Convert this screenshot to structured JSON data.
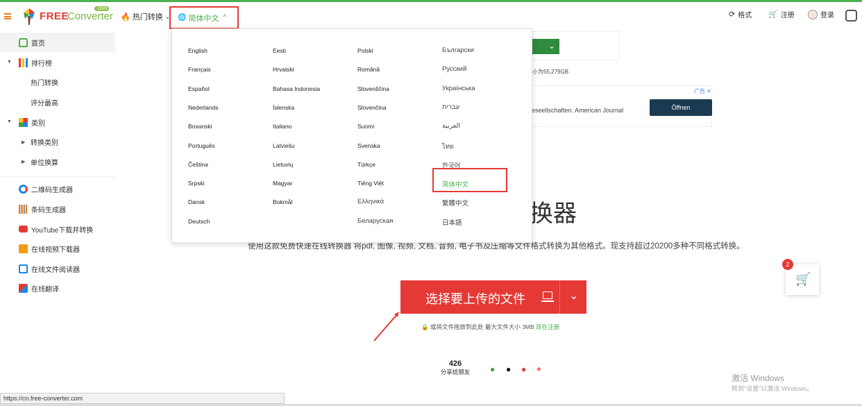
{
  "header": {
    "logo_free": "FREE",
    "logo_converter": "Converter",
    "logo_com": ".com",
    "hot": "热门转换",
    "lang_current": "简体中文",
    "formats": "格式",
    "register": "注册",
    "login": "登录"
  },
  "sidebar": {
    "home": "首页",
    "ranking": "排行榜",
    "hot_conv": "热门转换",
    "top_rated": "评分最高",
    "categories": "类别",
    "conv_cat": "转换类别",
    "unit_conv": "单位换算",
    "qr": "二维码生成器",
    "barcode": "条码生成器",
    "youtube": "YouTube下载并转换",
    "video_dl": "在线视频下载器",
    "doc_reader": "在线文件阅读器",
    "translate": "在线翻译"
  },
  "languages": {
    "col1": [
      "English",
      "Français",
      "Español",
      "Nederlands",
      "Bosanski",
      "Português",
      "Čeština",
      "Srpski",
      "Dansk",
      "Deutsch"
    ],
    "col2": [
      "Eesti",
      "Hrvatski",
      "Bahasa Indonesia",
      "Íslenska",
      "Italiano",
      "Latviešu",
      "Lietuvių",
      "Magyar",
      "Bokmål"
    ],
    "col3": [
      "Polski",
      "Română",
      "Slovenščina",
      "Slovenčina",
      "Suomi",
      "Svenska",
      "Türkçe",
      "Tiếng Việt",
      "Ελληνικά",
      "Беларуская"
    ],
    "col4": [
      "Български",
      "Русский",
      "Українська",
      "עברית",
      "العربية",
      "ไทย",
      "한국어",
      "简体中文",
      "繁體中文",
      "日本語"
    ]
  },
  "main": {
    "title_partial": "换器",
    "description": "使用这款免费快速在线转换器 将pdf, 图像, 视频, 文档, 音频, 电子书及压缩等文件格式转换为其他格式。现支持超过20200多种不同格式转换。",
    "upload_label": "选择要上传的文件",
    "upload_note": "或将文件拖放到此处 最大文件大小 3MB",
    "register_now": "现在注册",
    "share_count": "426",
    "share_label": "分享给朋友",
    "ad1_text": "小为55,279GB",
    "ad2_text": "eseellschaften. American Journal",
    "ad2_button": "Öffnen",
    "ad_tag": "广告",
    "cart_badge": "2"
  },
  "watermark": {
    "line1": "激活 Windows",
    "line2": "转到\"设置\"以激活 Windows。"
  },
  "status_url": "https://cn.free-converter.com",
  "colors": {
    "accent_green": "#4caf50",
    "accent_red": "#e53935"
  }
}
